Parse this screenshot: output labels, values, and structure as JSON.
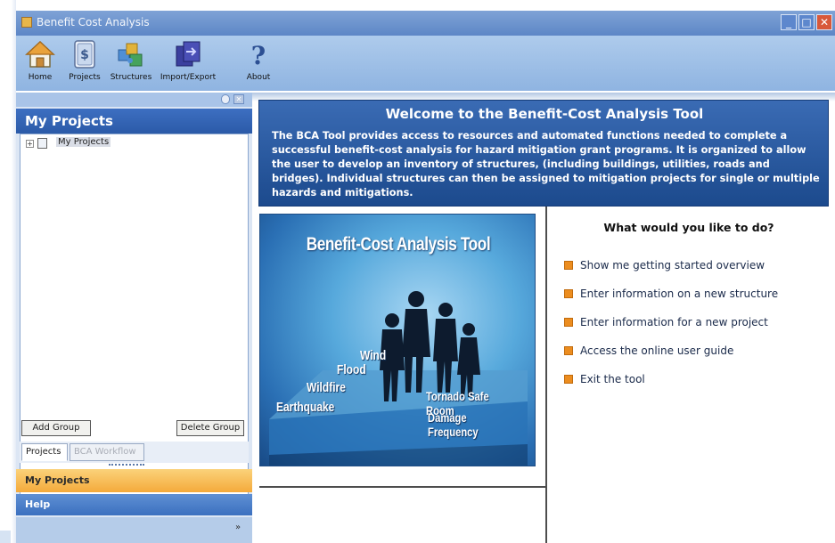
{
  "window": {
    "title": "Benefit Cost Analysis",
    "minimize": "_",
    "maximize": "□",
    "close": "✕"
  },
  "toolbar": {
    "items": [
      {
        "label": "Home",
        "icon": "home-icon"
      },
      {
        "label": "Projects",
        "icon": "dollar-document-icon"
      },
      {
        "label": "Structures",
        "icon": "structures-icon"
      },
      {
        "label": "Import/Export",
        "icon": "import-export-icon"
      },
      {
        "label": "About",
        "icon": "question-icon"
      }
    ]
  },
  "left_panel": {
    "title": "My Projects",
    "tree": [
      {
        "expander": "+",
        "label": "My Projects"
      }
    ],
    "add_group": "Add Group",
    "delete_group": "Delete Group",
    "tabs": [
      {
        "label": "Projects",
        "active": true
      },
      {
        "label": "BCA Workflow",
        "active": false
      }
    ],
    "nav": {
      "my_projects": "My Projects",
      "help": "Help",
      "chevron": "»"
    }
  },
  "welcome": {
    "title": "Welcome to the Benefit-Cost Analysis Tool",
    "text": "The BCA Tool provides access to resources and automated functions needed to complete a successful benefit-cost analysis for hazard mitigation grant programs.  It is organized to allow the user to develop an inventory of structures, (including buildings, utilities, roads and bridges). Individual structures can then be assigned to mitigation projects for single or multiple hazards and mitigations."
  },
  "hero": {
    "title": "Benefit-Cost Analysis Tool",
    "words": {
      "wind": "Wind",
      "flood": "Flood",
      "wildfire": "Wildfire",
      "earthquake": "Earthquake",
      "tornado": "Tornado Safe Room",
      "damage": "Damage Frequency"
    }
  },
  "actions": {
    "title": "What would you like to do?",
    "items": [
      "Show me getting started overview",
      "Enter information on a new structure",
      "Enter information for a new project",
      "Access the online user guide",
      "Exit the tool"
    ],
    "bullet_color": "#ec8d1f"
  },
  "colors": {
    "title_bar": "#5d86c6",
    "panel_header": "#2b5aa8",
    "welcome_bg": "#1c4a8d",
    "nav_active": "#f4aa3b"
  }
}
